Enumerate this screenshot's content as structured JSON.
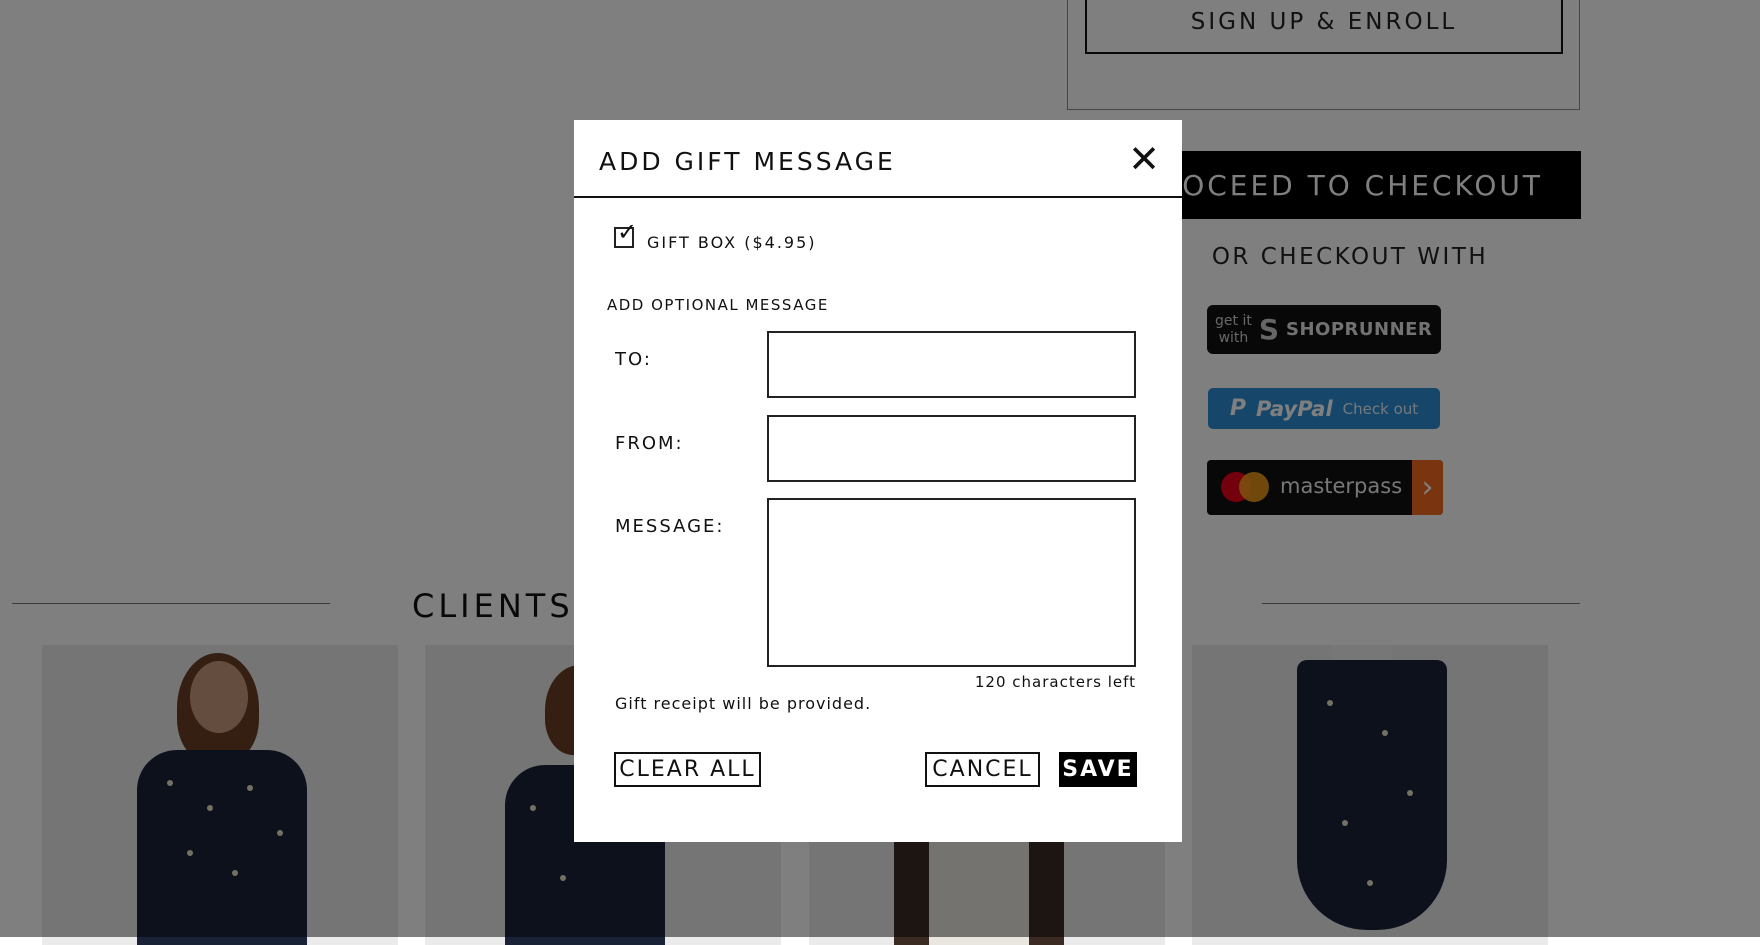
{
  "background": {
    "signup_button": "SIGN UP & ENROLL",
    "checkout_button": "OCEED TO CHECKOUT",
    "or_checkout_with": "OR CHECKOUT WITH",
    "shoprunner": {
      "get_it": "get it",
      "with": "with",
      "logo_icon": "S",
      "brand": "SHOPRUNNER"
    },
    "paypal": {
      "icon": "P",
      "brand": "PayPal",
      "action": "Check out"
    },
    "masterpass": {
      "brand": "masterpass",
      "arrow": "›"
    },
    "section_heading": "CLIENTS V"
  },
  "modal": {
    "title": "ADD GIFT MESSAGE",
    "close_symbol": "✕",
    "gift_box": {
      "label": "GIFT BOX ($4.95)",
      "checked": true,
      "tick": "✓"
    },
    "optional_label": "ADD OPTIONAL MESSAGE",
    "fields": {
      "to_label": "TO:",
      "to_value": "",
      "from_label": "FROM:",
      "from_value": "",
      "message_label": "MESSAGE:",
      "message_value": ""
    },
    "chars_left": "120 characters left",
    "receipt_note": "Gift receipt will be provided.",
    "buttons": {
      "clear_all": "CLEAR ALL",
      "cancel": "CANCEL",
      "save": "SAVE"
    }
  },
  "colors": {
    "overlay": "rgba(0,0,0,0.5)",
    "paypal_blue": "#2c8fd4",
    "masterpass_orange": "#f26b21"
  }
}
